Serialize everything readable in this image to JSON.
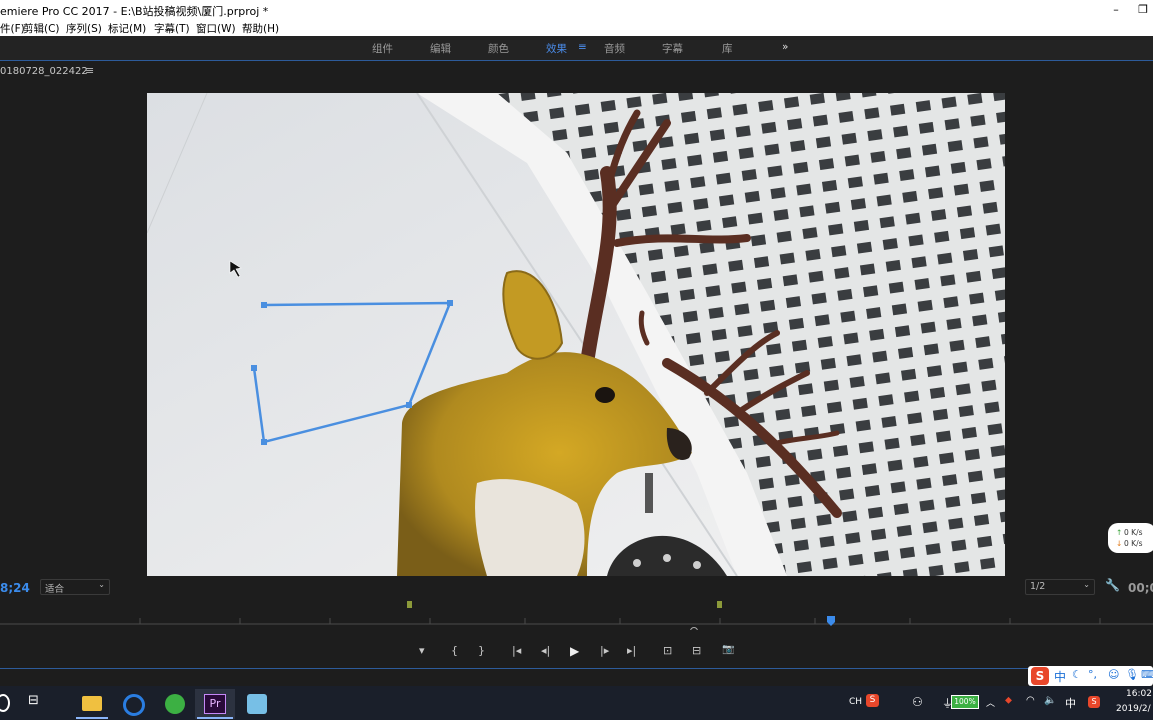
{
  "window": {
    "title": "emiere Pro CC 2017 - E:\\B站投稿视频\\厦门.prproj *",
    "minimize": "–",
    "restore": "❐"
  },
  "menu": [
    "件(F)",
    "剪辑(C)",
    "序列(S)",
    "标记(M)",
    "字幕(T)",
    "窗口(W)",
    "帮助(H)"
  ],
  "workspaces": [
    "组件",
    "编辑",
    "颜色",
    "效果",
    "音频",
    "字幕",
    "库"
  ],
  "active_workspace": "效果",
  "workspace_menu_icon": "≡",
  "workspace_more": "»",
  "panel": {
    "name": "0180728_022422",
    "menu_icon": "≡"
  },
  "monitor": {
    "timecode_left": "8;24",
    "zoom": "适合",
    "resolution": "1/2",
    "timecode_right": "00;0"
  },
  "controls": {
    "marker": "▾",
    "in": "{",
    "out": "}",
    "goto_in": "|◂",
    "step_back": "◂|",
    "play": "▶",
    "step_fwd": "|▸",
    "goto_out": "▸|",
    "insert": "⊡",
    "overwrite": "⊟",
    "export_frame": "📷"
  },
  "network": {
    "up": "0  K/s",
    "down": "0  K/s"
  },
  "ime_bar": {
    "logo": "S",
    "lang": "中"
  },
  "taskbar": {
    "tray_lang": "CH",
    "battery": "100%",
    "ime": "中",
    "time": "16:02",
    "date": "2019/2/"
  },
  "colors": {
    "accent": "#3b8beb",
    "mask": "#4a8fe0",
    "taskbar": "#1a1f2a"
  }
}
